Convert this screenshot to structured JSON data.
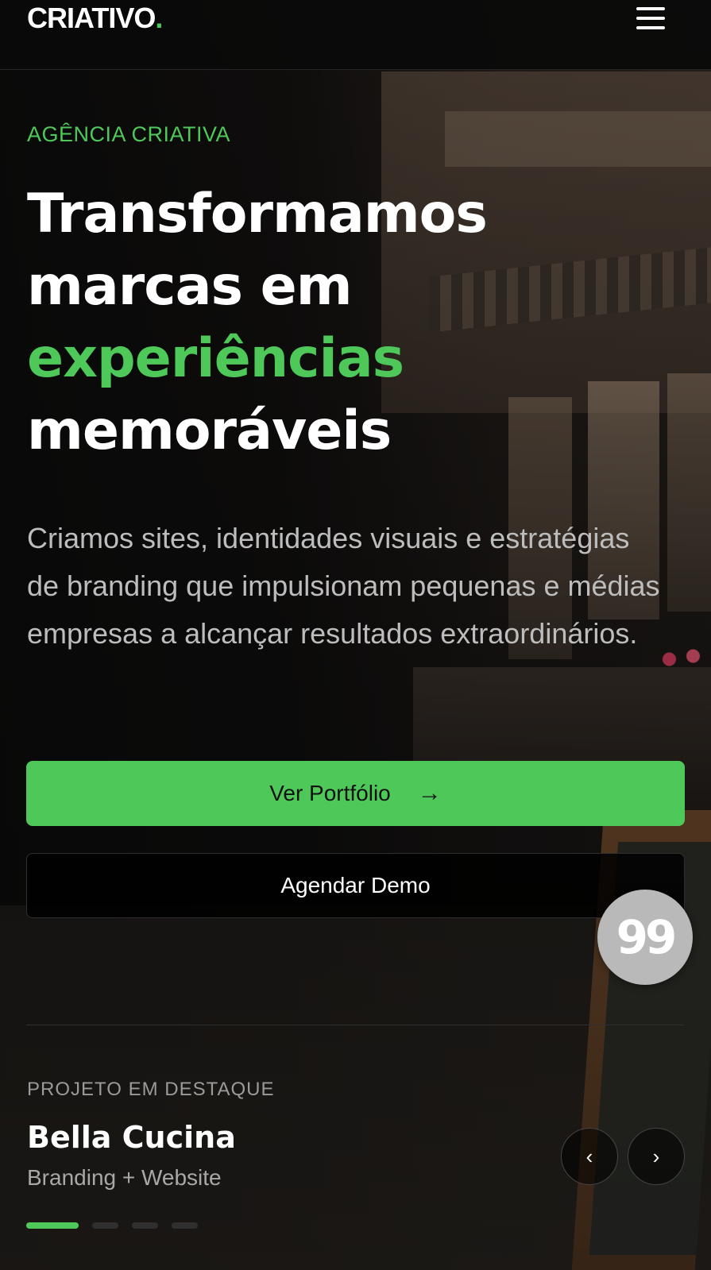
{
  "header": {
    "logo_text": "CRIATIVO",
    "logo_dot": ".",
    "menu_icon": "hamburger-menu-icon"
  },
  "hero": {
    "eyebrow": "AGÊNCIA CRIATIVA",
    "headline_line1": "Transformamos",
    "headline_line2": "marcas em",
    "headline_highlight": "experiências",
    "headline_line4": "memoráveis",
    "lead": "Criamos sites, identidades visuais e estratégias de branding que impulsionam pequenas e médias empresas a alcançar resultados extraordinários.",
    "primary_button": "Ver Portfólio",
    "primary_button_icon": "arrow-right-icon",
    "secondary_button": "Agendar Demo"
  },
  "floating_badge": {
    "text": "99"
  },
  "featured": {
    "eyebrow": "PROJETO EM DESTAQUE",
    "title": "Bella Cucina",
    "subtitle": "Branding + Website",
    "prev_icon": "chevron-left-icon",
    "next_icon": "chevron-right-icon",
    "slide_count": 4,
    "active_slide": 1
  },
  "colors": {
    "accent": "#4fc85a",
    "background": "#0b0b0b",
    "text": "#ffffff",
    "muted": "#bdbdbd"
  }
}
